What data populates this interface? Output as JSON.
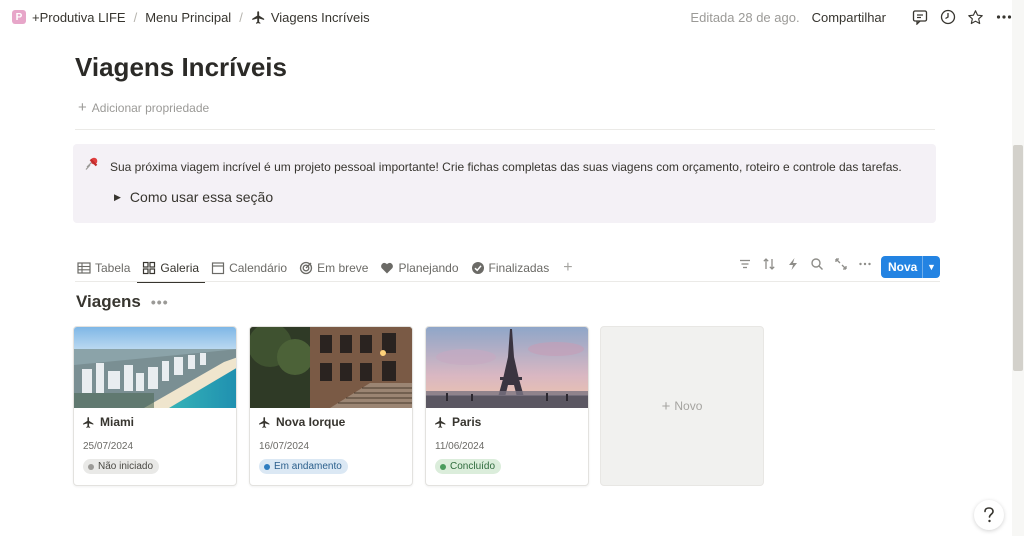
{
  "breadcrumb": {
    "workspace_icon": "P",
    "items": [
      "+Produtiva LIFE",
      "Menu Principal",
      "Viagens Incríveis"
    ]
  },
  "header": {
    "edited": "Editada 28 de ago.",
    "share": "Compartilhar",
    "icons": [
      "comment-icon",
      "clock-icon",
      "star-icon",
      "more-icon"
    ]
  },
  "page": {
    "title": "Viagens Incríveis",
    "add_property": "Adicionar propriedade"
  },
  "callout": {
    "icon": "pushpin-icon",
    "text": "Sua próxima viagem incrível é um projeto pessoal importante! Crie fichas completas das suas viagens com orçamento, roteiro e controle das tarefas.",
    "toggle": "Como usar essa seção"
  },
  "views": {
    "tabs": [
      {
        "label": "Tabela",
        "icon": "table-icon"
      },
      {
        "label": "Galeria",
        "icon": "gallery-icon",
        "active": true
      },
      {
        "label": "Calendário",
        "icon": "calendar-icon"
      },
      {
        "label": "Em breve",
        "icon": "target-icon"
      },
      {
        "label": "Planejando",
        "icon": "heart-icon"
      },
      {
        "label": "Finalizadas",
        "icon": "check-circle-icon"
      }
    ],
    "tools": [
      "filter-icon",
      "sort-icon",
      "automation-icon",
      "search-icon",
      "expand-icon",
      "more-icon"
    ],
    "new_button": "Nova",
    "accent": "#2383e2"
  },
  "gallery": {
    "title": "Viagens",
    "cards": [
      {
        "title": "Miami",
        "date": "25/07/2024",
        "status": "Não iniciado",
        "status_bg": "#e9e9e7",
        "status_dot": "#9b9a97"
      },
      {
        "title": "Nova Iorque",
        "date": "16/07/2024",
        "status": "Em andamento",
        "status_bg": "#dbe8f4",
        "status_dot": "#2f7dc0"
      },
      {
        "title": "Paris",
        "date": "11/06/2024",
        "status": "Concluído",
        "status_bg": "#dbeddb",
        "status_dot": "#4a9c5d"
      }
    ],
    "new_card": "Novo"
  }
}
